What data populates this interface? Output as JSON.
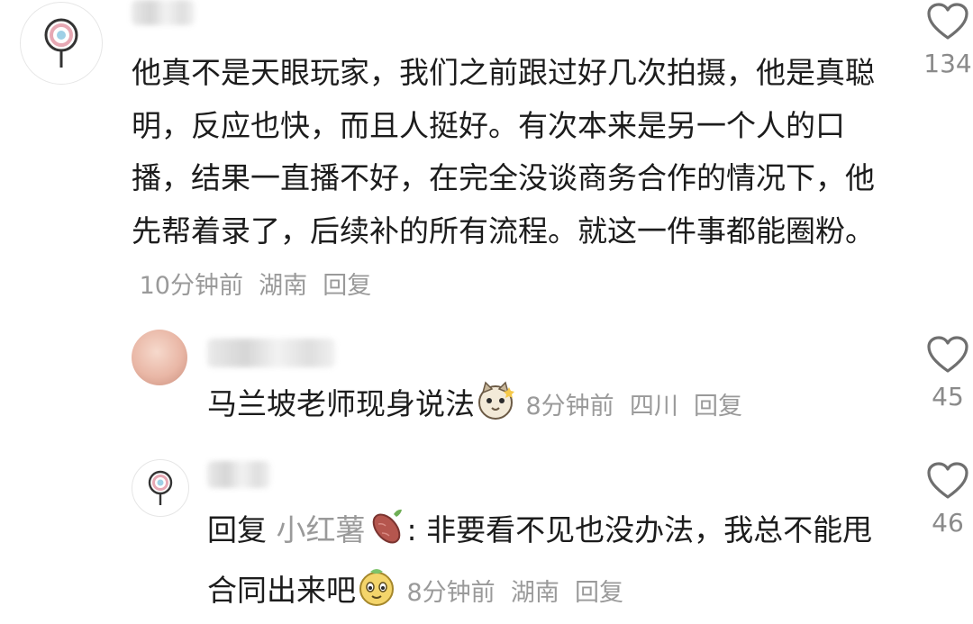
{
  "comments": [
    {
      "text": "他真不是天眼玩家，我们之前跟过好几次拍摄，他是真聪明，反应也快，而且人挺好。有次本来是另一个人的口播，结果一直播不好，在完全没谈商务合作的情况下，他先帮着录了，后续补的所有流程。就这一件事都能圈粉。",
      "time": "10分钟前",
      "location": "湖南",
      "reply_label": "回复",
      "likes": "134"
    },
    {
      "text": "马兰坡老师现身说法",
      "emoji": "cat-face-emoji",
      "time": "8分钟前",
      "location": "四川",
      "reply_label": "回复",
      "likes": "45"
    },
    {
      "prefix": "回复",
      "mention": "小红薯",
      "mention_icon": "sweet-potato-icon",
      "colon": ":",
      "text": " 非要看不见也没办法，我总不能甩合同出来吧",
      "emoji": "doge-emoji",
      "time": "8分钟前",
      "location": "湖南",
      "reply_label": "回复",
      "likes": "46"
    }
  ],
  "colors": {
    "text": "#1c1c1c",
    "meta": "#9a9a9a",
    "like_icon": "#6f6f6f"
  }
}
